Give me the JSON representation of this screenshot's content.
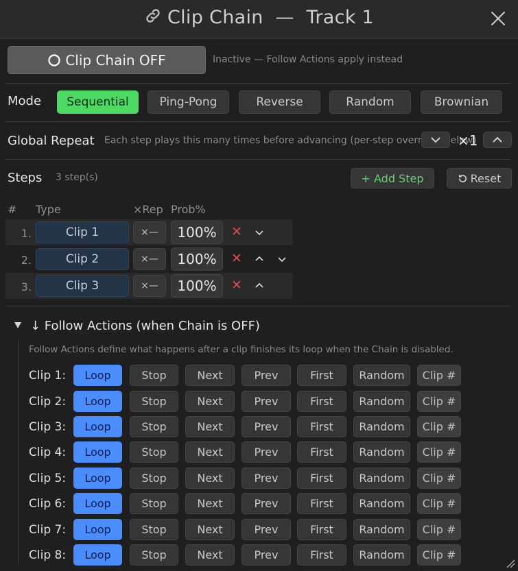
{
  "window": {
    "title": "Clip Chain",
    "title_sep": "—",
    "track": "Track 1"
  },
  "chain_toggle": {
    "label": "Clip Chain OFF",
    "status": "Inactive — Follow Actions apply instead"
  },
  "mode": {
    "label": "Mode",
    "options": [
      "Sequential",
      "Ping-Pong",
      "Reverse",
      "Random",
      "Brownian"
    ],
    "selected": "Sequential"
  },
  "global_repeat": {
    "label": "Global Repeat",
    "hint": "Each step plays this many times before advancing (per-step overrides below)",
    "value": "×1"
  },
  "steps": {
    "label": "Steps",
    "count": "3 step(s)",
    "add_label": "+ Add Step",
    "reset_label": "Reset",
    "headers": {
      "num": "#",
      "type": "Type",
      "rep": "×Rep",
      "prob": "Prob%"
    },
    "rows": [
      {
        "num": "1.",
        "clip": "Clip 1",
        "rep": "×—",
        "prob": "100%"
      },
      {
        "num": "2.",
        "clip": "Clip 2",
        "rep": "×—",
        "prob": "100%"
      },
      {
        "num": "3.",
        "clip": "Clip 3",
        "rep": "×—",
        "prob": "100%"
      }
    ]
  },
  "follow_actions": {
    "title": "↓ Follow Actions  (when Chain is OFF)",
    "description": "Follow Actions define what happens after a clip finishes its loop when the Chain is disabled.",
    "actions": [
      "Loop",
      "Stop",
      "Next",
      "Prev",
      "First",
      "Random",
      "Clip #"
    ],
    "clips": [
      {
        "label": "Clip 1:",
        "selected": "Loop"
      },
      {
        "label": "Clip 2:",
        "selected": "Loop"
      },
      {
        "label": "Clip 3:",
        "selected": "Loop"
      },
      {
        "label": "Clip 4:",
        "selected": "Loop"
      },
      {
        "label": "Clip 5:",
        "selected": "Loop"
      },
      {
        "label": "Clip 6:",
        "selected": "Loop"
      },
      {
        "label": "Clip 7:",
        "selected": "Loop"
      },
      {
        "label": "Clip 8:",
        "selected": "Loop"
      }
    ]
  },
  "colors": {
    "mode_active": "#4cd964",
    "action_active": "#4a8dff",
    "delete": "#e04a4a",
    "add_step_text": "#5fd36f"
  },
  "icons": [
    "link-icon",
    "close-icon",
    "circle-icon",
    "chevron-down-icon",
    "chevron-up-icon",
    "reset-icon",
    "delete-icon",
    "triangle-down-icon",
    "resize-grip-icon"
  ]
}
